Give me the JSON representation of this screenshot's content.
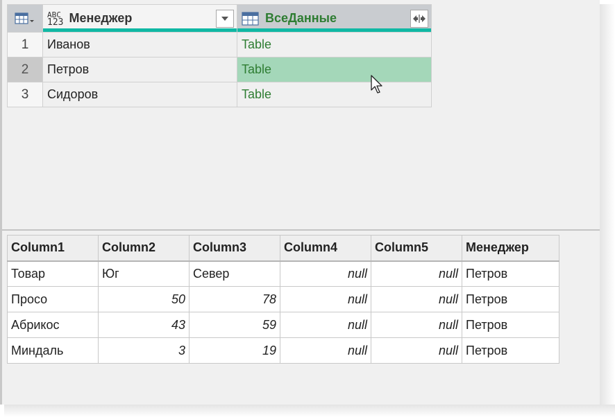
{
  "query_table": {
    "columns": [
      {
        "label": "Менеджер",
        "type_icon_top": "ABC",
        "type_icon_bottom": "123"
      },
      {
        "label": "ВсеДанные"
      }
    ],
    "rows": [
      {
        "num": "1",
        "manager": "Иванов",
        "data": "Table"
      },
      {
        "num": "2",
        "manager": "Петров",
        "data": "Table"
      },
      {
        "num": "3",
        "manager": "Сидоров",
        "data": "Table"
      }
    ],
    "selected_row": 2
  },
  "preview_table": {
    "headers": [
      "Column1",
      "Column2",
      "Column3",
      "Column4",
      "Column5",
      "Менеджер"
    ],
    "rows": [
      [
        "Товар",
        "Юг",
        "Север",
        "null",
        "null",
        "Петров"
      ],
      [
        "Просо",
        "50",
        "78",
        "null",
        "null",
        "Петров"
      ],
      [
        "Абрикос",
        "43",
        "59",
        "null",
        "null",
        "Петров"
      ],
      [
        "Миндаль",
        "3",
        "19",
        "null",
        "null",
        "Петров"
      ]
    ]
  },
  "colors": {
    "accent_teal": "#10b8a4",
    "table_link_green": "#2e7d32",
    "selected_cell": "#a4d7b9"
  },
  "icons": {
    "table_selector": "table-grid-icon",
    "column_type": "abc-123-icon",
    "table_column": "table-icon",
    "dropdown": "chevron-down-icon",
    "expand": "expand-arrows-icon",
    "pointer": "mouse-cursor-icon"
  }
}
